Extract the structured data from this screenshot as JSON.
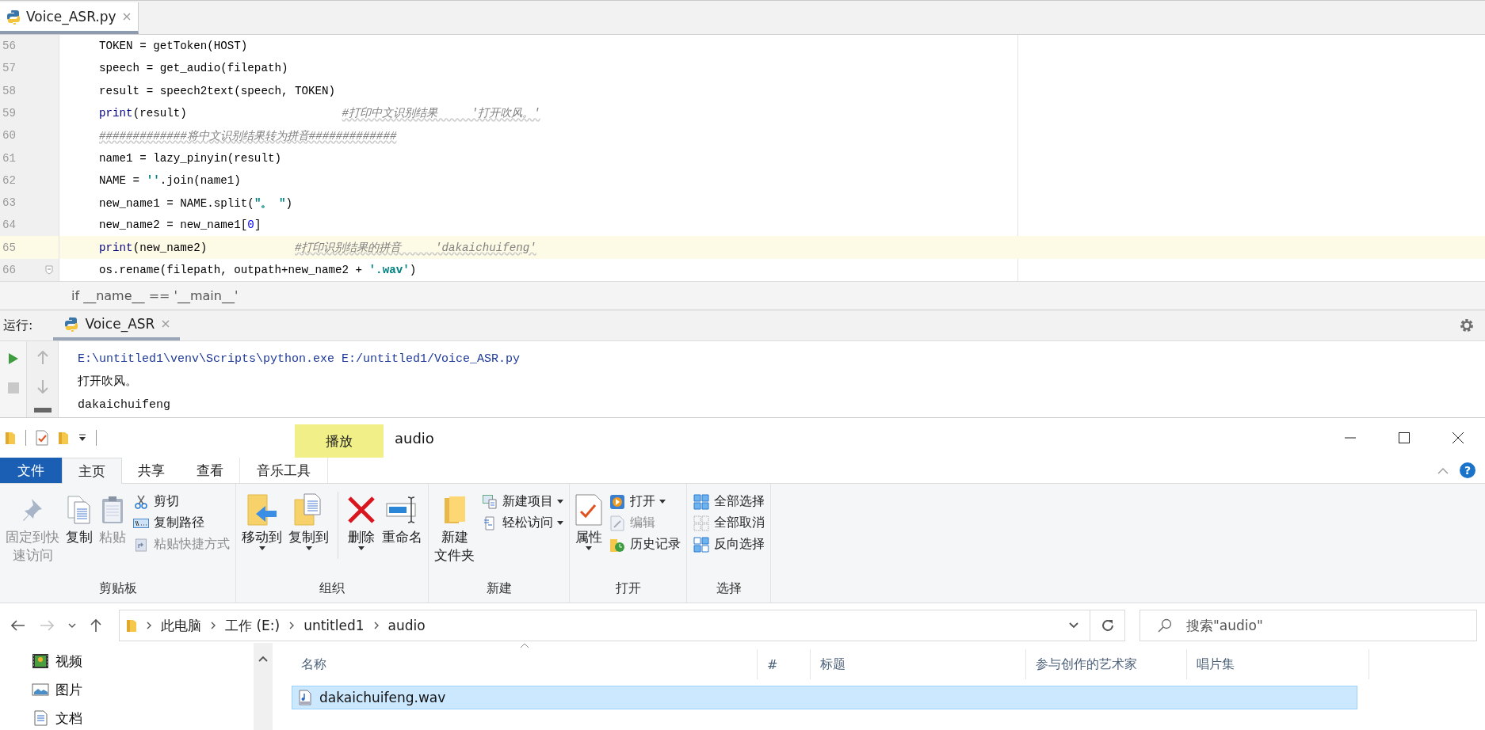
{
  "editor": {
    "tabs": [
      {
        "label": "Voice_ASR.py",
        "selected": true
      }
    ],
    "lines": [
      {
        "number": "56",
        "current": false,
        "fold_marker": false,
        "tokens": [
          {
            "kind": "plain",
            "text": "TOKEN = getToken(HOST)"
          }
        ]
      },
      {
        "number": "57",
        "current": false,
        "fold_marker": false,
        "tokens": [
          {
            "kind": "plain",
            "text": "speech = get_audio(filepath)"
          }
        ]
      },
      {
        "number": "58",
        "current": false,
        "fold_marker": false,
        "tokens": [
          {
            "kind": "plain",
            "text": "result = speech2text(speech, TOKEN)"
          }
        ]
      },
      {
        "number": "59",
        "current": false,
        "fold_marker": false,
        "tokens": [
          {
            "kind": "builtin",
            "text": "print"
          },
          {
            "kind": "plain",
            "text": "(result)                       "
          },
          {
            "kind": "comment",
            "text": "#打印中文识别结果     '打开吹风。'"
          }
        ]
      },
      {
        "number": "60",
        "current": false,
        "fold_marker": false,
        "tokens": [
          {
            "kind": "comment",
            "text": "#############将中文识别结果转为拼音#############"
          }
        ]
      },
      {
        "number": "61",
        "current": false,
        "fold_marker": false,
        "tokens": [
          {
            "kind": "plain",
            "text": "name1 = lazy_pinyin(result)"
          }
        ]
      },
      {
        "number": "62",
        "current": false,
        "fold_marker": false,
        "tokens": [
          {
            "kind": "plain",
            "text": "NAME = "
          },
          {
            "kind": "string",
            "text": "''"
          },
          {
            "kind": "plain",
            "text": ".join(name1)"
          }
        ]
      },
      {
        "number": "63",
        "current": false,
        "fold_marker": false,
        "tokens": [
          {
            "kind": "plain",
            "text": "new_name1 = NAME.split("
          },
          {
            "kind": "string",
            "text": "\"。 \""
          },
          {
            "kind": "plain",
            "text": ")"
          }
        ]
      },
      {
        "number": "64",
        "current": false,
        "fold_marker": false,
        "tokens": [
          {
            "kind": "plain",
            "text": "new_name2 = new_name1["
          },
          {
            "kind": "number",
            "text": "0"
          },
          {
            "kind": "plain",
            "text": "]"
          }
        ]
      },
      {
        "number": "65",
        "current": true,
        "fold_marker": false,
        "tokens": [
          {
            "kind": "builtin",
            "text": "print"
          },
          {
            "kind": "plain",
            "text": "(new_name2)             "
          },
          {
            "kind": "comment",
            "text": "#打印识别结果的拼音     'dakaichuifeng'"
          }
        ]
      },
      {
        "number": "66",
        "current": false,
        "fold_marker": true,
        "tokens": [
          {
            "kind": "plain",
            "text": "os.rename(filepath, outpath+new_name2 + "
          },
          {
            "kind": "string",
            "text": "'.wav'"
          },
          {
            "kind": "plain",
            "text": ")"
          }
        ]
      }
    ],
    "breadcrumb": "if __name__ == '__main__'"
  },
  "run_panel": {
    "label": "运行:",
    "tabs": [
      {
        "label": "Voice_ASR",
        "selected": true
      }
    ],
    "output": [
      {
        "kind": "command",
        "text": "E:\\untitled1\\venv\\Scripts\\python.exe E:/untitled1/Voice_ASR.py"
      },
      {
        "kind": "plain",
        "text": "打开吹风。"
      },
      {
        "kind": "plain",
        "text": "dakaichuifeng"
      }
    ]
  },
  "explorer": {
    "context_label": "播放",
    "title": "audio",
    "help": "?",
    "tabs": [
      {
        "label": "文件",
        "kind": "file",
        "selected": false
      },
      {
        "label": "主页",
        "kind": "normal",
        "selected": true
      },
      {
        "label": "共享",
        "kind": "normal",
        "selected": false
      },
      {
        "label": "查看",
        "kind": "normal",
        "selected": false
      },
      {
        "label": "音乐工具",
        "kind": "contextual",
        "selected": false
      }
    ],
    "ribbon_groups": [
      {
        "label": "剪贴板",
        "items": [
          {
            "kind": "large",
            "label_lines": [
              "固定到快",
              "速访问"
            ],
            "disabled": true,
            "menu": false
          },
          {
            "kind": "large",
            "label_lines": [
              "复制"
            ],
            "disabled": false,
            "menu": false
          },
          {
            "kind": "large",
            "label_lines": [
              "粘贴"
            ],
            "disabled": true,
            "menu": false
          },
          {
            "kind": "small",
            "label": "剪切",
            "disabled": false,
            "menu": false
          },
          {
            "kind": "small",
            "label": "复制路径",
            "disabled": false,
            "menu": false
          },
          {
            "kind": "small",
            "label": "粘贴快捷方式",
            "disabled": true,
            "menu": false
          }
        ]
      },
      {
        "label": "组织",
        "items": [
          {
            "kind": "large",
            "label_lines": [
              "移动到"
            ],
            "disabled": false,
            "menu": true
          },
          {
            "kind": "large",
            "label_lines": [
              "复制到"
            ],
            "disabled": false,
            "menu": true
          },
          {
            "kind": "divider"
          },
          {
            "kind": "large",
            "label_lines": [
              "删除"
            ],
            "disabled": false,
            "menu": true
          },
          {
            "kind": "large",
            "label_lines": [
              "重命名"
            ],
            "disabled": false,
            "menu": false
          }
        ]
      },
      {
        "label": "新建",
        "items": [
          {
            "kind": "large",
            "label_lines": [
              "新建",
              "文件夹"
            ],
            "disabled": false,
            "menu": false
          },
          {
            "kind": "small",
            "label": "新建项目",
            "disabled": false,
            "menu": true
          },
          {
            "kind": "small",
            "label": "轻松访问",
            "disabled": false,
            "menu": true
          }
        ]
      },
      {
        "label": "打开",
        "items": [
          {
            "kind": "large",
            "label_lines": [
              "属性"
            ],
            "disabled": false,
            "menu": true
          },
          {
            "kind": "small",
            "label": "打开",
            "disabled": false,
            "menu": true
          },
          {
            "kind": "small",
            "label": "编辑",
            "disabled": true,
            "menu": false
          },
          {
            "kind": "small",
            "label": "历史记录",
            "disabled": false,
            "menu": false
          }
        ]
      },
      {
        "label": "选择",
        "items": [
          {
            "kind": "small",
            "label": "全部选择",
            "disabled": false,
            "menu": false
          },
          {
            "kind": "small",
            "label": "全部取消",
            "disabled": false,
            "menu": false
          },
          {
            "kind": "small",
            "label": "反向选择",
            "disabled": false,
            "menu": false
          }
        ]
      }
    ],
    "address": {
      "crumbs": [
        "此电脑",
        "工作 (E:)",
        "untitled1",
        "audio"
      ]
    },
    "search": {
      "placeholder": "搜索\"audio\""
    },
    "nav": [
      {
        "label": "视频"
      },
      {
        "label": "图片"
      },
      {
        "label": "文档"
      }
    ],
    "columns": [
      "名称",
      "#",
      "标题",
      "参与创作的艺术家",
      "唱片集"
    ],
    "files": [
      {
        "name": "dakaichuifeng.wav",
        "selected": true
      }
    ]
  }
}
